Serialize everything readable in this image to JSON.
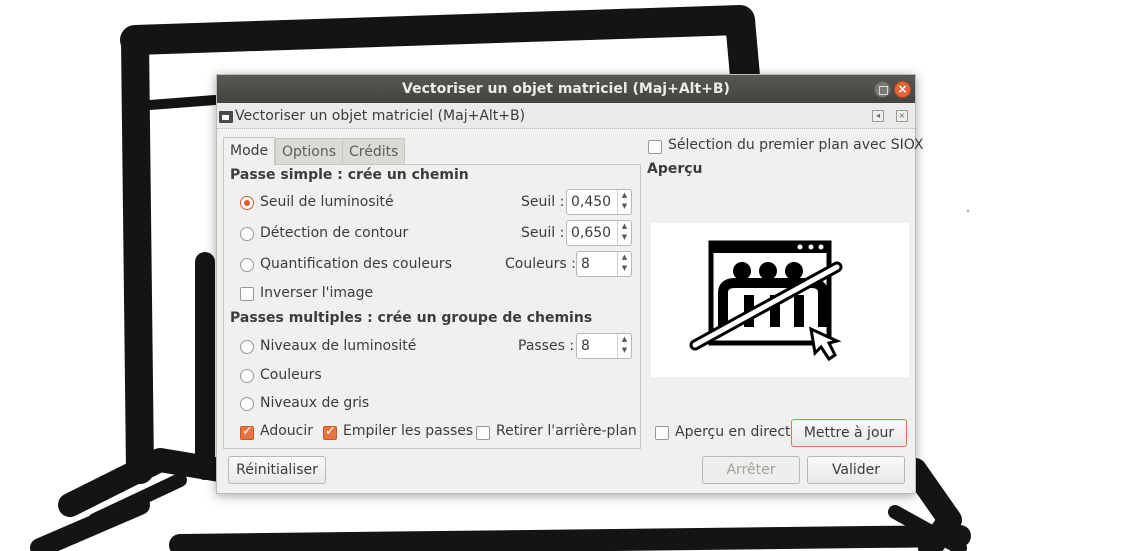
{
  "window": {
    "title": "Vectoriser un objet matriciel (Maj+Alt+B)",
    "dock_title": "Vectoriser un objet matriciel (Maj+Alt+B)",
    "close_glyph": "×"
  },
  "tabs": [
    {
      "label": "Mode",
      "active": true
    },
    {
      "label": "Options",
      "active": false
    },
    {
      "label": "Crédits",
      "active": false
    }
  ],
  "single_scan": {
    "header": "Passe simple : crée un chemin",
    "brightness": {
      "label": "Seuil de luminosité",
      "selected": true,
      "param_label": "Seuil :",
      "value": "0,450"
    },
    "edge": {
      "label": "Détection de contour",
      "selected": false,
      "param_label": "Seuil :",
      "value": "0,650"
    },
    "color_quant": {
      "label": "Quantification des couleurs",
      "selected": false,
      "param_label": "Couleurs :",
      "value": "8"
    },
    "invert": {
      "label": "Inverser l'image",
      "checked": false
    }
  },
  "multi_scan": {
    "header": "Passes multiples : crée un groupe de chemins",
    "brightness_steps": {
      "label": "Niveaux de luminosité",
      "selected": false,
      "param_label": "Passes :",
      "value": "8"
    },
    "colors": {
      "label": "Couleurs",
      "selected": false
    },
    "grays": {
      "label": "Niveaux de gris",
      "selected": false
    },
    "smooth": {
      "label": "Adoucir",
      "checked": true
    },
    "stack": {
      "label": "Empiler les passes",
      "checked": true
    },
    "remove_bg": {
      "label": "Retirer l'arrière-plan",
      "checked": false
    }
  },
  "right_panel": {
    "siox": {
      "label": "Sélection du premier plan avec SIOX",
      "checked": false
    },
    "preview_header": "Aperçu",
    "live_preview": {
      "label": "Aperçu en direct",
      "checked": false
    },
    "update_button": "Mettre à jour"
  },
  "footer": {
    "reset_button": "Réinitialiser",
    "stop_button": "Arrêter",
    "ok_button": "Valider"
  },
  "colors": {
    "accent": "#e05c2c",
    "titlebar": "#4f4e4a",
    "dialog_bg": "#f1f0ef"
  }
}
